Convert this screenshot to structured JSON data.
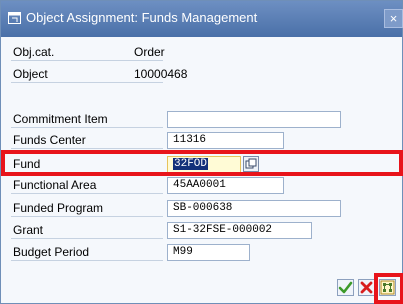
{
  "dialog": {
    "title": "Object Assignment: Funds Management",
    "close_glyph": "×"
  },
  "header": {
    "obj_cat_label": "Obj.cat.",
    "obj_cat_value": "Order",
    "object_label": "Object",
    "object_value": "10000468"
  },
  "fields": {
    "commitment_item": {
      "label": "Commitment Item",
      "value": ""
    },
    "funds_center": {
      "label": "Funds Center",
      "value": "11316"
    },
    "fund": {
      "label": "Fund",
      "value": "32FOD"
    },
    "functional_area": {
      "label": "Functional Area",
      "value": "45AA0001"
    },
    "funded_program": {
      "label": "Funded Program",
      "value": "SB-000638"
    },
    "grant": {
      "label": "Grant",
      "value": "S1-32FSE-000002"
    },
    "budget_period": {
      "label": "Budget Period",
      "value": "M99"
    }
  },
  "colors": {
    "highlight": "#e8141b",
    "title_bar": "#5a7db5",
    "ok_green": "#3c9a2a",
    "cancel_red": "#d81e1e"
  },
  "icons": {
    "title": "dialog-window-icon",
    "f4": "value-help-icon",
    "ok": "checkmark-icon",
    "cancel": "cancel-x-icon",
    "details": "more-fields-icon"
  }
}
